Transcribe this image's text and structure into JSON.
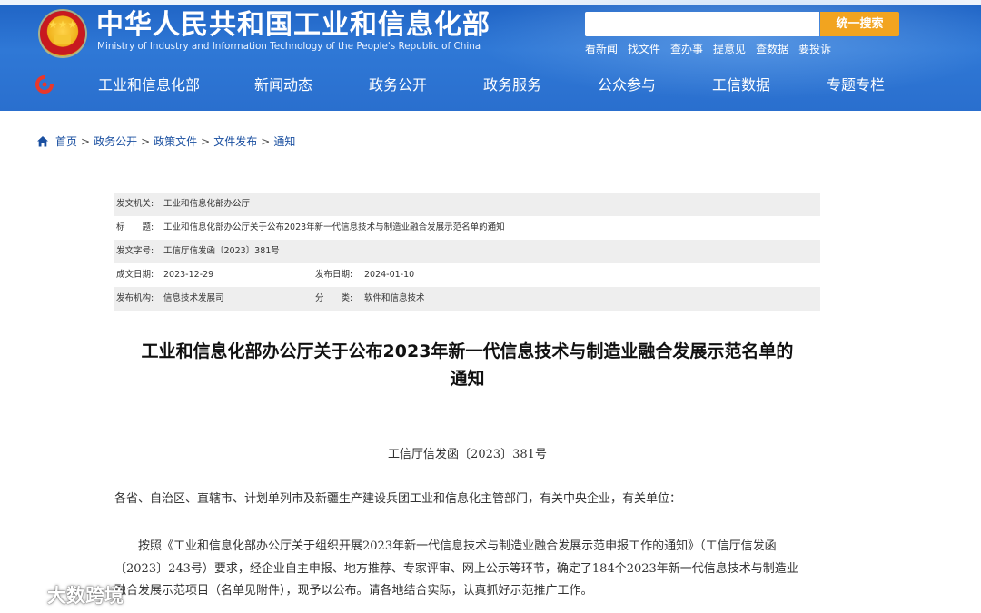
{
  "header": {
    "title_cn": "中华人民共和国工业和信息化部",
    "title_en": "Ministry of Industry and Information Technology of the People's Republic of China",
    "search": {
      "placeholder": "",
      "button_label": "统一搜索"
    },
    "quick_links": [
      "看新闻",
      "找文件",
      "查办事",
      "提意见",
      "查数据",
      "要投诉"
    ],
    "nav_items": [
      "工业和信息化部",
      "新闻动态",
      "政务公开",
      "政务服务",
      "公众参与",
      "工信数据",
      "专题专栏"
    ]
  },
  "breadcrumb": [
    "首页",
    "政务公开",
    "政策文件",
    "文件发布",
    "通知"
  ],
  "meta": {
    "issuer_label": "发文机关:",
    "issuer": "工业和信息化部办公厅",
    "title_label": "标　　题:",
    "title": "工业和信息化部办公厅关于公布2023年新一代信息技术与制造业融合发展示范名单的通知",
    "doc_no_label": "发文字号:",
    "doc_no": "工信厅信发函〔2023〕381号",
    "created_label": "成文日期:",
    "created": "2023-12-29",
    "published_label": "发布日期:",
    "published": "2024-01-10",
    "org_label": "发布机构:",
    "org": "信息技术发展司",
    "category_label": "分　　类:",
    "category": "软件和信息技术"
  },
  "document": {
    "title_line1": "工业和信息化部办公厅关于公布2023年新一代信息技术与制造业融合发展示范名单的",
    "title_line2": "通知",
    "number": "工信厅信发函〔2023〕381号",
    "addressee": "各省、自治区、直辖市、计划单列市及新疆生产建设兵团工业和信息化主管部门，有关中央企业，有关单位：",
    "body_lines": [
      "按照《工业和信息化部办公厅关于组织开展2023年新一代信息技术与制造业融合发展示范申报工作的通知》（工信厅信发函",
      "〔2023〕243号）要求，经企业自主申报、地方推荐、专家评审、网上公示等环节，确定了184个2023年新一代信息技术与制造业",
      "融合发展示范项目（名单见附件），现予以公布。请各地结合实际，认真抓好示范推广工作。"
    ]
  },
  "watermark": "大数跨境",
  "colors": {
    "header_blue": "#2a6fce",
    "search_button": "#f2a41f",
    "link_blue": "#1a4fa0",
    "meta_shade": "#eeeeee"
  }
}
